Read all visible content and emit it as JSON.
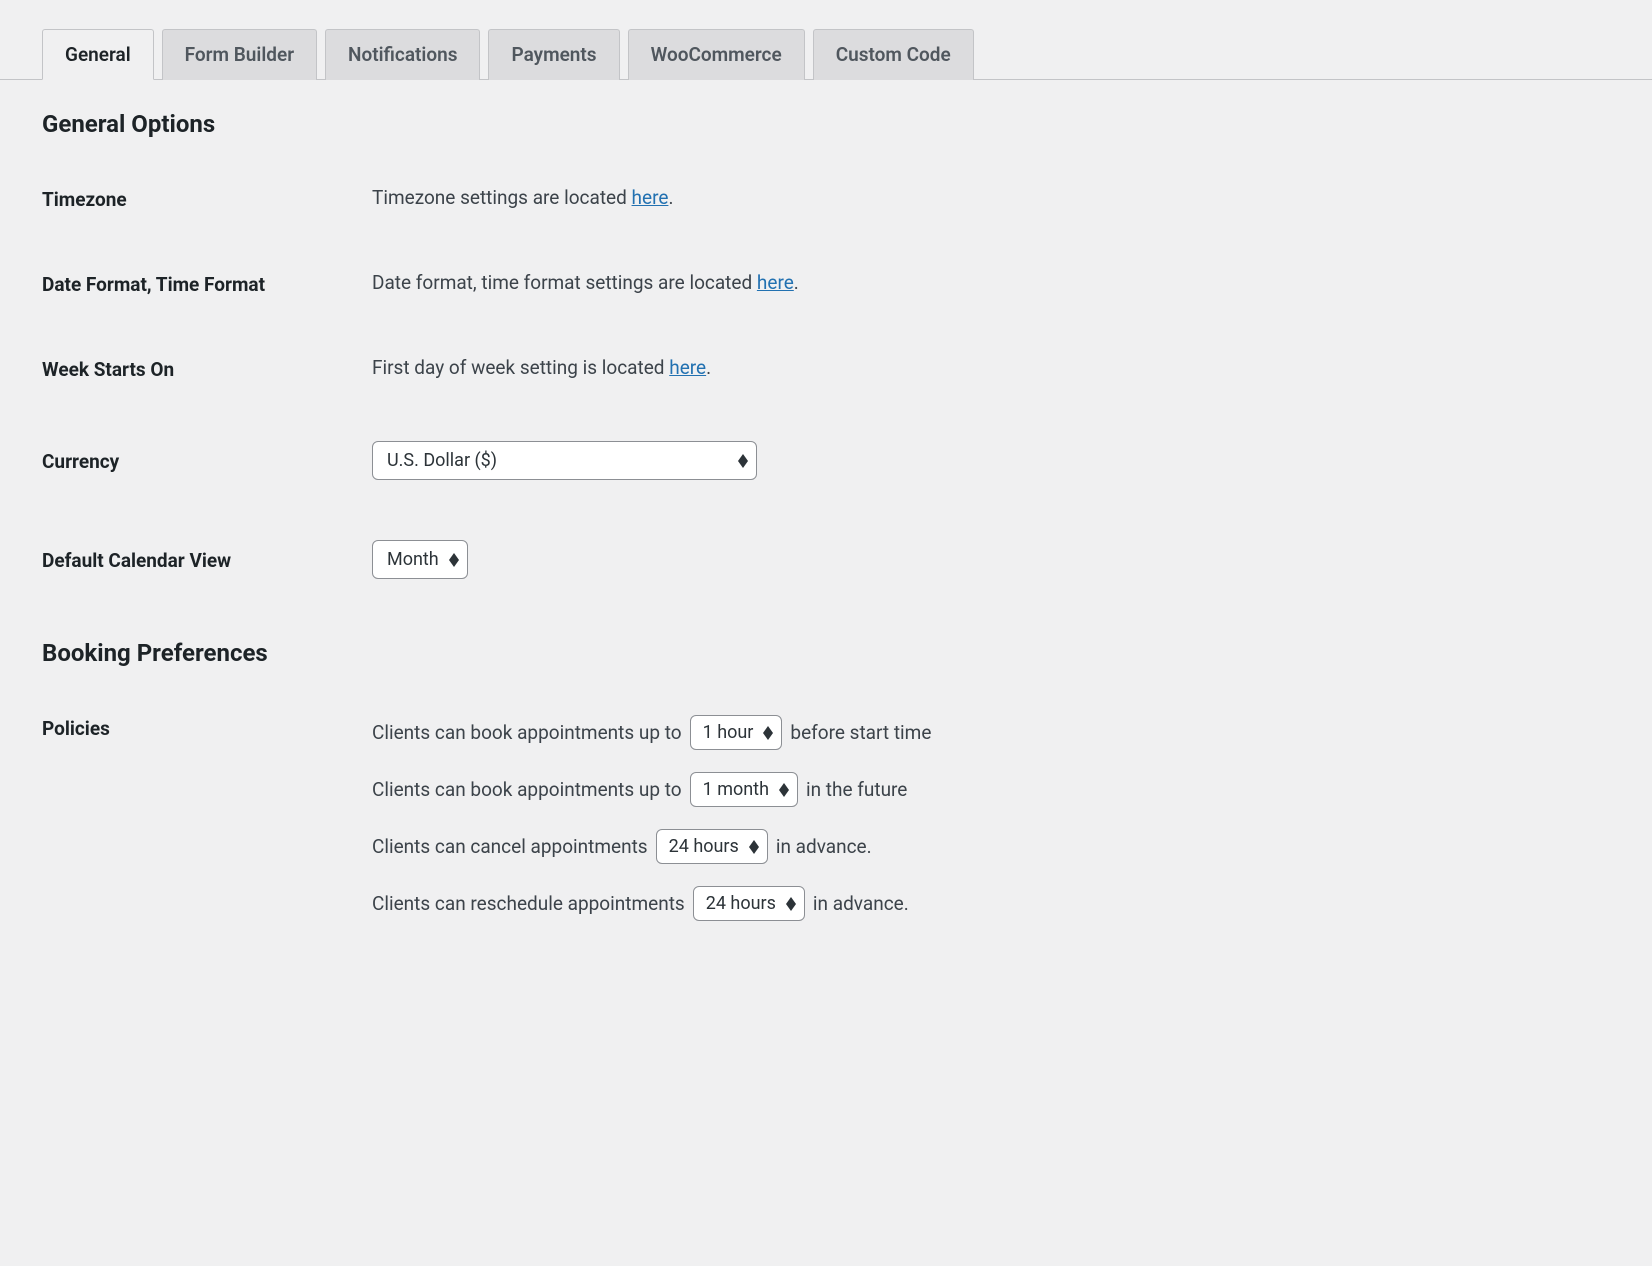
{
  "tabs": {
    "general": "General",
    "form_builder": "Form Builder",
    "notifications": "Notifications",
    "payments": "Payments",
    "woocommerce": "WooCommerce",
    "custom_code": "Custom Code"
  },
  "sections": {
    "general_options": "General Options",
    "booking_preferences": "Booking Preferences"
  },
  "fields": {
    "timezone": {
      "label": "Timezone",
      "text_before": "Timezone settings are located ",
      "link": "here",
      "text_after": "."
    },
    "date_time_format": {
      "label": "Date Format, Time Format",
      "text_before": "Date format, time format settings are located ",
      "link": "here",
      "text_after": "."
    },
    "week_starts": {
      "label": "Week Starts On",
      "text_before": "First day of week setting is located ",
      "link": "here",
      "text_after": "."
    },
    "currency": {
      "label": "Currency",
      "value": "U.S. Dollar ($)"
    },
    "default_calendar_view": {
      "label": "Default Calendar View",
      "value": "Month"
    },
    "policies": {
      "label": "Policies",
      "book_before": {
        "prefix": "Clients can book appointments up to",
        "value": "1 hour",
        "suffix": "before start time"
      },
      "book_future": {
        "prefix": "Clients can book appointments up to",
        "value": "1 month",
        "suffix": "in the future"
      },
      "cancel": {
        "prefix": "Clients can cancel appointments",
        "value": "24 hours",
        "suffix": "in advance."
      },
      "reschedule": {
        "prefix": "Clients can reschedule appointments",
        "value": "24 hours",
        "suffix": "in advance."
      }
    }
  }
}
